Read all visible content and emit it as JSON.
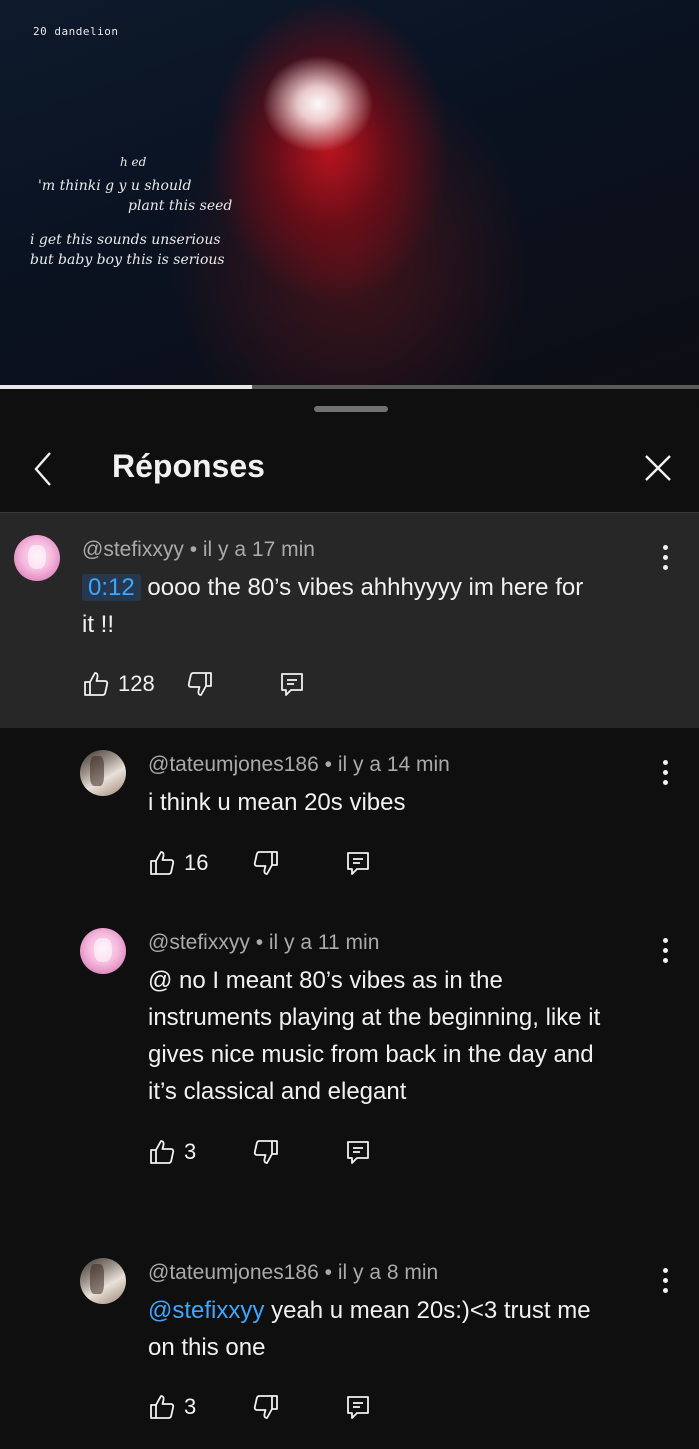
{
  "video": {
    "tag": "20  dandelion",
    "lyrics": [
      "h       ed",
      "'m thinki g y u should",
      "plant this seed",
      "i get this sounds unserious",
      "but baby boy this is serious"
    ],
    "progress": 0.36
  },
  "panel": {
    "title": "Réponses",
    "back_icon": "chevron-left-icon",
    "close_icon": "close-icon"
  },
  "comments": [
    {
      "author": "@stefixxyy",
      "sep": "•",
      "time": "il y a 17 min",
      "timestamp": "0:12",
      "text": "oooo the 80’s vibes ahhhyyyy im here for it !!",
      "text_lines": [
        "oooo the 80’s vibes ahhhyyyy im here for",
        "it !!"
      ],
      "likes": "128",
      "avatar": "pink"
    },
    {
      "author": "@tateumjones186",
      "sep": "•",
      "time": "il y a 14 min",
      "text": "i think u mean 20s vibes",
      "likes": "16",
      "avatar": "tan"
    },
    {
      "author": "@stefixxyy",
      "sep": "•",
      "time": "il y a 11 min",
      "text_lines": [
        "@ no I meant 80’s vibes as in the",
        "instruments playing at the beginning, like it",
        "gives nice music from back in the day and",
        "it’s classical and elegant"
      ],
      "likes": "3",
      "avatar": "pink"
    },
    {
      "author": "@tateumjones186",
      "sep": "•",
      "time": "il y a 8 min",
      "mention": "@stefixxyy",
      "text_lines": [
        "yeah u mean 20s:)<3 trust me",
        "on this one"
      ],
      "likes": "3",
      "avatar": "tan"
    }
  ],
  "icons": {
    "like": "thumbs-up-icon",
    "dislike": "thumbs-down-icon",
    "reply": "reply-icon",
    "more": "more-vertical-icon"
  },
  "colors": {
    "background": "#0f0f0f",
    "highlight": "#272727",
    "link": "#3ea6ff",
    "muted_text": "#aaaaaa"
  }
}
